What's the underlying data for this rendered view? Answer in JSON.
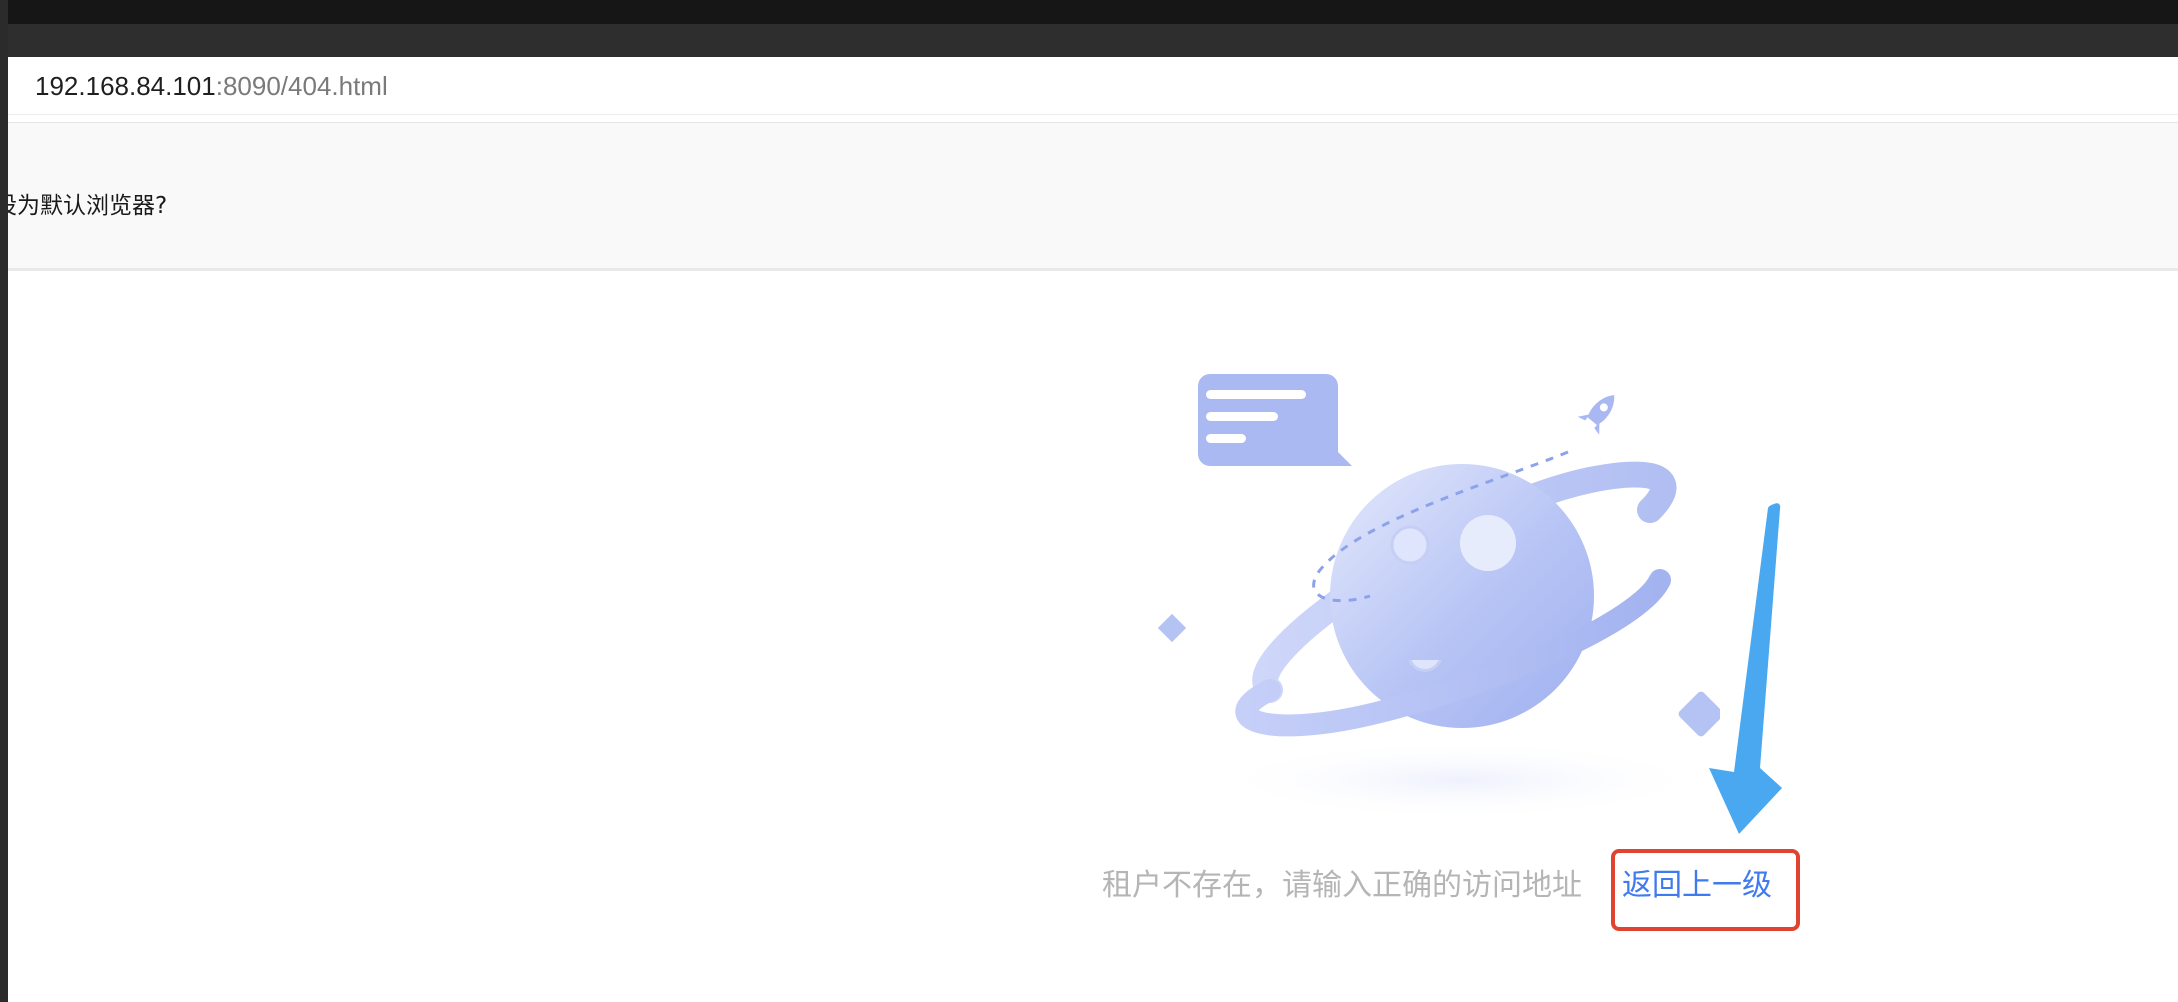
{
  "browser": {
    "url_host": "192.168.84.101",
    "url_rest": ":8090/404.html",
    "default_browser_prompt": "设为默认浏览器?"
  },
  "error_page": {
    "message": "租户不存在，请输入正确的访问地址",
    "back_link_label": "返回上一级"
  },
  "annotation": {
    "arrow_color": "#4aa8f0",
    "highlight_color": "#e0432f"
  },
  "colors": {
    "link": "#3f7bef",
    "message_text": "#b5b5b5",
    "illustration_primary": "#a9b8f2"
  }
}
